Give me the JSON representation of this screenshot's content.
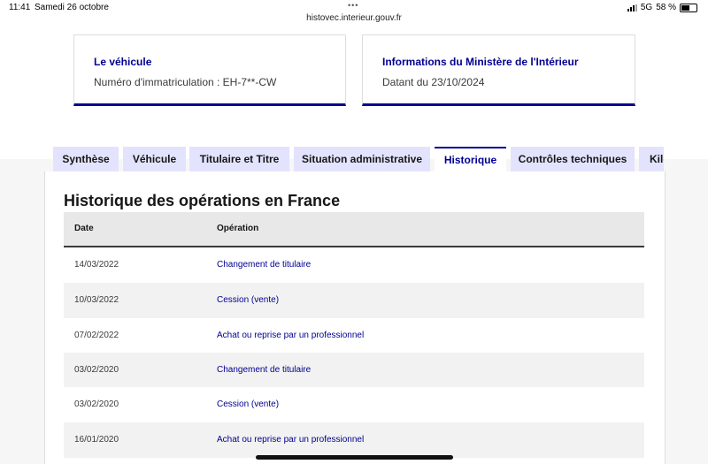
{
  "status_bar": {
    "time": "11:41",
    "date": "Samedi 26 octobre",
    "url": "histovec.interieur.gouv.fr",
    "network": "5G",
    "battery": "58 %"
  },
  "cards": [
    {
      "title": "Le véhicule",
      "text": "Numéro d'immatriculation : EH-7**-CW"
    },
    {
      "title": "Informations du Ministère de l'Intérieur",
      "text": "Datant du 23/10/2024"
    }
  ],
  "tabs": [
    {
      "label": "Synthèse",
      "active": false
    },
    {
      "label": "Véhicule",
      "active": false
    },
    {
      "label": "Titulaire et Titre",
      "active": false
    },
    {
      "label": "Situation administrative",
      "active": false
    },
    {
      "label": "Historique",
      "active": true
    },
    {
      "label": "Contrôles techniques",
      "active": false
    },
    {
      "label": "Kilo",
      "active": false
    }
  ],
  "section": {
    "title": "Historique des opérations en France",
    "columns": [
      "Date",
      "Opération"
    ],
    "rows": [
      {
        "date": "14/03/2022",
        "operation": "Changement de titulaire"
      },
      {
        "date": "10/03/2022",
        "operation": "Cession (vente)"
      },
      {
        "date": "07/02/2022",
        "operation": "Achat ou reprise par un professionnel"
      },
      {
        "date": "03/02/2020",
        "operation": "Changement de titulaire"
      },
      {
        "date": "03/02/2020",
        "operation": "Cession (vente)"
      },
      {
        "date": "16/01/2020",
        "operation": "Achat ou reprise par un professionnel"
      }
    ]
  },
  "colors": {
    "accent": "#000091",
    "tab_bg": "#e3e3fd"
  }
}
